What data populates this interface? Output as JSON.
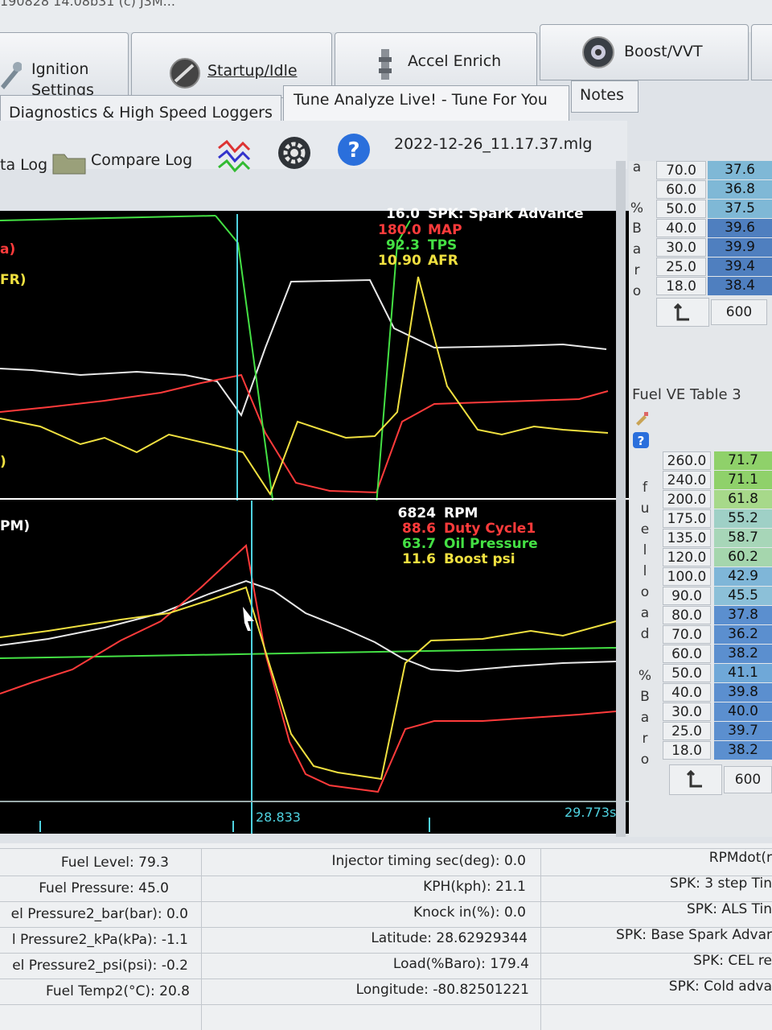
{
  "window": {
    "top_fragment": "190828 14.08b31 (c) J3M..."
  },
  "main_tabs": [
    {
      "label_line1": "Ignition",
      "label_line2": "Settings",
      "icon": "wrench-icon"
    },
    {
      "label": "Startup/Idle",
      "icon": "gauge-icon"
    },
    {
      "label": "Accel Enrich",
      "icon": "injector-icon"
    },
    {
      "label": "Boost/VVT",
      "icon": "turbo-icon"
    }
  ],
  "sub_tabs": [
    {
      "label": "Diagnostics & High Speed Loggers"
    },
    {
      "label": "Tune Analyze Live! - Tune For You"
    },
    {
      "label": "Notes"
    }
  ],
  "toolbar": {
    "data_log_label": "ta Log",
    "compare_log_label": "Compare Log",
    "filename": "2022-12-26_11.17.37.mlg"
  },
  "plot1": {
    "left_labels": [
      "a)",
      "FR)",
      ")"
    ],
    "legend": [
      {
        "value": "16.0",
        "name": "SPK: Spark Advance",
        "color": "#ffffff"
      },
      {
        "value": "180.0",
        "name": "MAP",
        "color": "#ff3b3b"
      },
      {
        "value": "92.3",
        "name": "TPS",
        "color": "#44e044"
      },
      {
        "value": "10.90",
        "name": "AFR",
        "color": "#f0e040"
      }
    ]
  },
  "plot2": {
    "left_labels": [
      "PM)"
    ],
    "legend": [
      {
        "value": "6824",
        "name": "RPM",
        "color": "#ffffff"
      },
      {
        "value": "88.6",
        "name": "Duty Cycle1",
        "color": "#ff3b3b"
      },
      {
        "value": "63.7",
        "name": "Oil Pressure",
        "color": "#44e044"
      },
      {
        "value": "11.6",
        "name": "Boost psi",
        "color": "#f0e040"
      }
    ],
    "cursor_time": "28.833",
    "end_time": "29.773s."
  },
  "table_top": {
    "axis_letters": [
      "a",
      "%",
      "B",
      "a",
      "r",
      "o"
    ],
    "loads": [
      "70.0",
      "60.0",
      "50.0",
      "40.0",
      "30.0",
      "25.0",
      "18.0"
    ],
    "values": [
      "37.6",
      "36.8",
      "37.5",
      "39.6",
      "39.9",
      "39.4",
      "38.4"
    ],
    "rpm_cell": "600"
  },
  "table_ve3": {
    "title": "Fuel VE Table 3",
    "axis_letters": [
      "f",
      "u",
      "e",
      "l",
      "l",
      "o",
      "a",
      "d",
      "",
      "%",
      "B",
      "a",
      "r",
      "o"
    ],
    "loads": [
      "260.0",
      "240.0",
      "200.0",
      "175.0",
      "135.0",
      "120.0",
      "100.0",
      "90.0",
      "80.0",
      "70.0",
      "60.0",
      "50.0",
      "40.0",
      "30.0",
      "25.0",
      "18.0"
    ],
    "values": [
      "71.7",
      "71.1",
      "61.8",
      "55.2",
      "58.7",
      "60.2",
      "42.9",
      "45.5",
      "37.8",
      "36.2",
      "38.2",
      "41.1",
      "39.8",
      "40.0",
      "39.7",
      "38.2"
    ],
    "rpm_cell": "600"
  },
  "bottom_table": {
    "col1": [
      "Fuel Level: 79.3",
      "Fuel Pressure: 45.0",
      "el Pressure2_bar(bar): 0.0",
      "l Pressure2_kPa(kPa): -1.1",
      "el Pressure2_psi(psi): -0.2",
      "Fuel Temp2(°C): 20.8"
    ],
    "col2": [
      "Injector timing sec(deg): 0.0",
      "KPH(kph): 21.1",
      "Knock in(%): 0.0",
      "Latitude: 28.62929344",
      "Load(%Baro): 179.4",
      "Longitude: -80.82501221"
    ],
    "col3": [
      "RPMdot(r",
      "SPK: 3 step Tin",
      "SPK: ALS Tin",
      "SPK: Base Spark Advar",
      "SPK: CEL re",
      "SPK: Cold adva"
    ]
  }
}
